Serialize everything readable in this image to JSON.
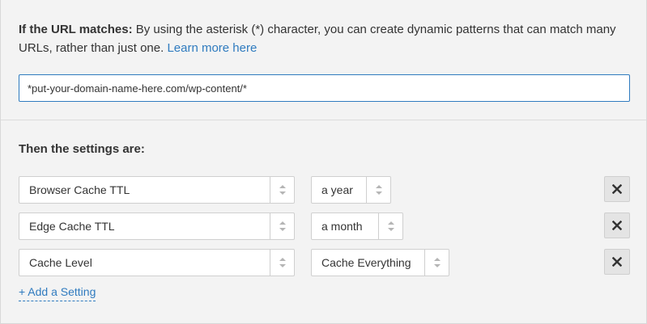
{
  "rule": {
    "condition_label": "If the URL matches:",
    "condition_text": " By using the asterisk (*) character, you can create dynamic patterns that can match many URLs, rather than just one. ",
    "learn_more_label": "Learn more here",
    "url_value": "*put-your-domain-name-here.com/wp-content/*"
  },
  "settings": {
    "heading": "Then the settings are:",
    "rows": [
      {
        "setting": "Browser Cache TTL",
        "value": "a year"
      },
      {
        "setting": "Edge Cache TTL",
        "value": "a month"
      },
      {
        "setting": "Cache Level",
        "value": "Cache Everything"
      }
    ],
    "add_label": "+ Add a Setting"
  },
  "colors": {
    "link": "#2f7bbf",
    "background": "#f3f3f3",
    "input_border_focus": "#2f7bbf"
  },
  "icons": {
    "remove": "close-icon",
    "select_arrows": "sort-arrows-icon"
  }
}
